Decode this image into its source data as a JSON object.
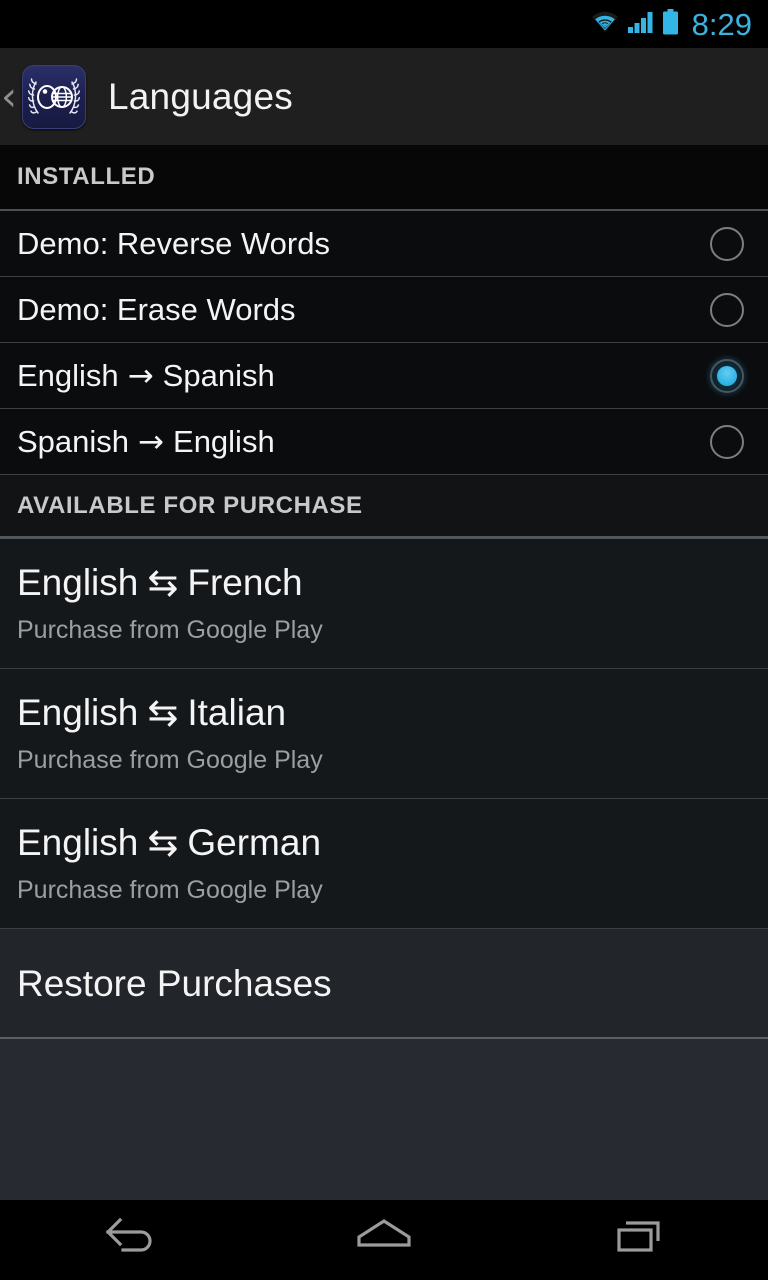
{
  "statusbar": {
    "time": "8:29",
    "icons": [
      "wifi-icon",
      "cellular-signal-icon",
      "battery-icon"
    ],
    "accent_color": "#33b5e5"
  },
  "actionbar": {
    "back_label": "‹",
    "app_icon": "laurel-globe-icon",
    "title": "Languages",
    "background_color": "#1f1f1f"
  },
  "sections": [
    {
      "header": "INSTALLED",
      "items": [
        {
          "label_full": "Demo: Reverse Words",
          "left": "Demo: Reverse Words",
          "arrow": "",
          "right": "",
          "selected": false
        },
        {
          "label_full": "Demo: Erase Words",
          "left": "Demo: Erase Words",
          "arrow": "",
          "right": "",
          "selected": false
        },
        {
          "label_full": "English → Spanish",
          "left": "English",
          "arrow": "→",
          "right": "Spanish",
          "selected": true
        },
        {
          "label_full": "Spanish → English",
          "left": "Spanish",
          "arrow": "→",
          "right": "English",
          "selected": false
        }
      ]
    },
    {
      "header": "AVAILABLE FOR PURCHASE",
      "items": [
        {
          "left": "English",
          "arrow": "⇆",
          "right": "French",
          "subtitle": "Purchase from Google Play"
        },
        {
          "left": "English",
          "arrow": "⇆",
          "right": "Italian",
          "subtitle": "Purchase from Google Play"
        },
        {
          "left": "English",
          "arrow": "⇆",
          "right": "German",
          "subtitle": "Purchase from Google Play"
        }
      ]
    }
  ],
  "restore": {
    "label": "Restore Purchases"
  },
  "navbar": {
    "back": "back-icon",
    "home": "home-icon",
    "recents": "recents-icon"
  }
}
